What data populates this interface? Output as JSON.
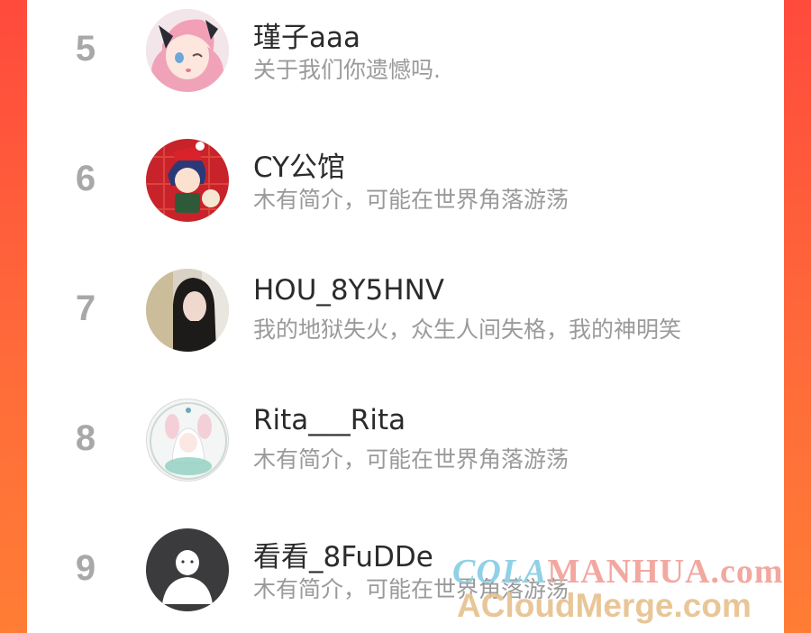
{
  "list": [
    {
      "rank": "5",
      "name": "瑾子aaa",
      "bio": "关于我们你遗憾吗.",
      "avatar_icon": "anime-girl-pink-hair-avatar"
    },
    {
      "rank": "6",
      "name": "CY公馆",
      "bio": "木有简介，可能在世界角落游荡",
      "avatar_icon": "anime-boy-santa-avatar"
    },
    {
      "rank": "7",
      "name": "HOU_8Y5HNV",
      "bio": "我的地狱失火，众生人间失格，我的神明笑",
      "avatar_icon": "girl-photo-avatar"
    },
    {
      "rank": "8",
      "name": "Rita___Rita",
      "bio": "木有简介，可能在世界角落游荡",
      "avatar_icon": "anime-girl-white-hair-avatar"
    },
    {
      "rank": "9",
      "name": "看看_8FuDDe",
      "bio": "木有简介，可能在世界角落游荡",
      "avatar_icon": "default-user-avatar"
    }
  ],
  "watermark": {
    "line1_a": "COLA",
    "line1_b": "MANHUA.com",
    "line2": "ACloudMerge.com"
  },
  "colors": {
    "background": "#ff5a3a",
    "rank": "#a8a8a8",
    "name": "#2b2b2b",
    "bio": "#9a9a9a"
  }
}
